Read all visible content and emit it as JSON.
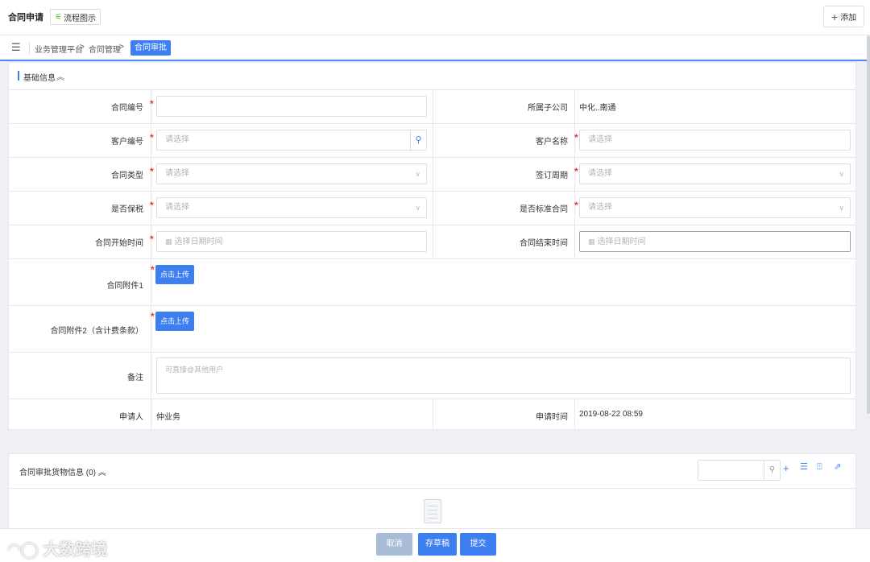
{
  "header": {
    "title": "合同申请",
    "flow_button": "流程图示",
    "add_button": "添加"
  },
  "breadcrumb": {
    "items": [
      "业务管理平台",
      "合同管理"
    ],
    "separator": ">",
    "active": "合同审批"
  },
  "section1": {
    "title": "基础信息",
    "collapse_icon": "double-chevron-up-icon"
  },
  "form": {
    "contract_no": {
      "label": "合同编号",
      "value": ""
    },
    "company": {
      "label": "所属子公司",
      "value": "中化..南通"
    },
    "customer_no": {
      "label": "客户编号",
      "placeholder": "请选择"
    },
    "customer_name": {
      "label": "客户名称",
      "placeholder": "请选择"
    },
    "contract_type": {
      "label": "合同类型",
      "placeholder": "请选择"
    },
    "sign_period": {
      "label": "签订周期",
      "placeholder": "请选择"
    },
    "bonded": {
      "label": "是否保税",
      "placeholder": "请选择"
    },
    "standard": {
      "label": "是否标准合同",
      "placeholder": "请选择"
    },
    "start_time": {
      "label": "合同开始时间",
      "placeholder": "选择日期时间"
    },
    "end_time": {
      "label": "合同结束时间",
      "placeholder": "选择日期时间"
    },
    "attachment1": {
      "label": "合同附件1",
      "button": "点击上传"
    },
    "attachment2": {
      "label": "合同附件2（含计费条款）",
      "button": "点击上传"
    },
    "remark": {
      "label": "备注",
      "placeholder": "可直接@其他用户"
    },
    "applicant": {
      "label": "申请人",
      "value": "仲业务"
    },
    "apply_time": {
      "label": "申请时间",
      "value": "2019-08-22 08:59"
    },
    "required_mark": "*"
  },
  "section2": {
    "title": "合同审批货物信息 (0)"
  },
  "footer": {
    "cancel": "取消",
    "save_draft": "存草稿",
    "submit": "提交",
    "watermark": "大数跨境"
  },
  "colors": {
    "accent": "#3d7ff0",
    "required": "#e53935",
    "disabled": "#a8bcd8"
  }
}
